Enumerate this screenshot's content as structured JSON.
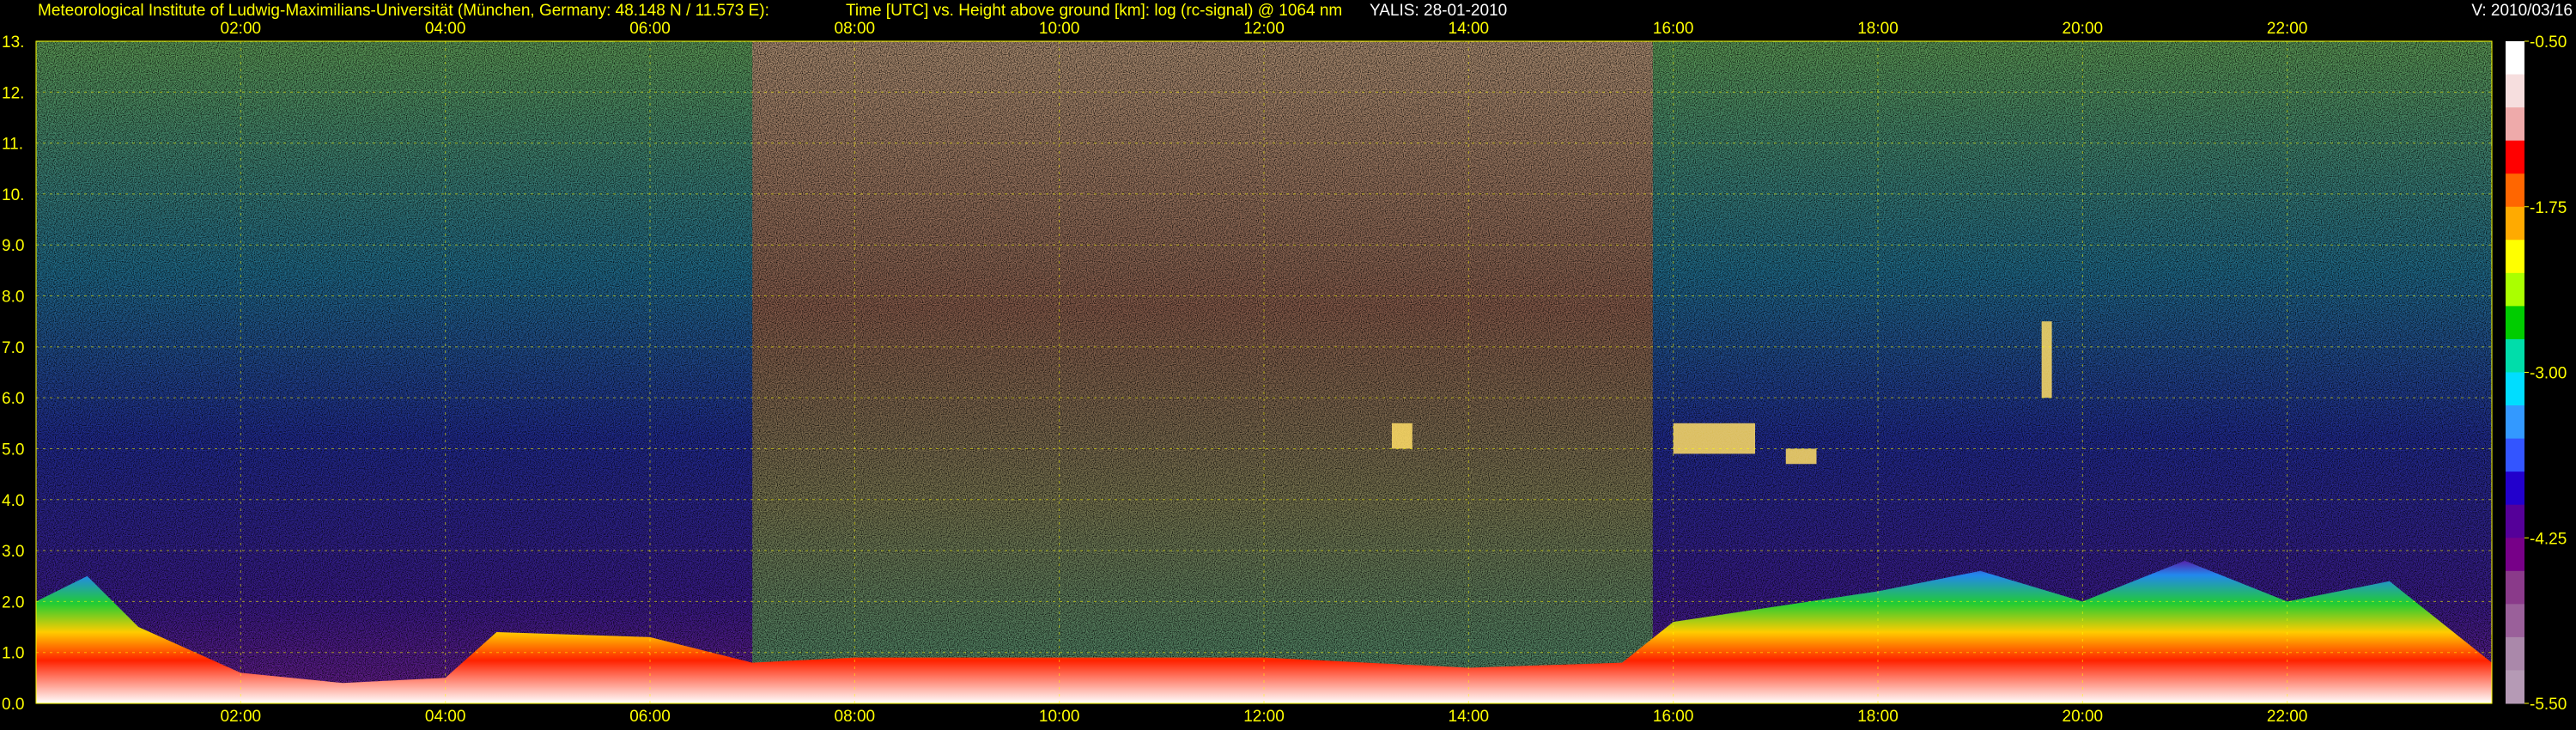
{
  "header": {
    "institute": "Meteorological Institute of Ludwig-Maximilians-Universität (München, Germany: 48.148 N / 11.573 E):",
    "title": "Time [UTC] vs. Height above ground [km]: log (rc-signal) @ 1064 nm",
    "instrument": "YALIS: 28-01-2010",
    "version": "V: 2010/03/16"
  },
  "chart_data": {
    "type": "heatmap",
    "x_ticks": [
      "02:00",
      "04:00",
      "06:00",
      "08:00",
      "10:00",
      "12:00",
      "14:00",
      "16:00",
      "18:00",
      "20:00",
      "22:00"
    ],
    "xlim_hours": [
      0,
      24
    ],
    "y_ticks": [
      "0.0",
      "1.0",
      "2.0",
      "3.0",
      "4.0",
      "5.0",
      "6.0",
      "7.0",
      "8.0",
      "9.0",
      "10.",
      "11.",
      "12.",
      "13."
    ],
    "ylim_km": [
      0,
      13
    ],
    "grid": true,
    "colorbar": {
      "labels": [
        "-0.50",
        "-1.75",
        "-3.00",
        "-4.25",
        "-5.50"
      ],
      "range": [
        -5.5,
        -0.5
      ],
      "colors": [
        "#ffffff",
        "#f6dede",
        "#eeaaaa",
        "#ff0000",
        "#ff6600",
        "#ffaa00",
        "#ffff00",
        "#aaff00",
        "#00cc00",
        "#00ddaa",
        "#00ddff",
        "#3399ff",
        "#3355ff",
        "#2200cc",
        "#550099",
        "#770088",
        "#8a3a8a",
        "#9a609a",
        "#aa88aa",
        "#b59ab5"
      ]
    },
    "boundary_layer_top_km": [
      [
        0.0,
        2.0
      ],
      [
        0.5,
        2.5
      ],
      [
        1.0,
        1.5
      ],
      [
        2.0,
        0.6
      ],
      [
        3.0,
        0.4
      ],
      [
        4.0,
        0.5
      ],
      [
        4.5,
        1.4
      ],
      [
        6.0,
        1.3
      ],
      [
        7.0,
        0.8
      ],
      [
        8.0,
        0.9
      ],
      [
        10.0,
        0.9
      ],
      [
        12.0,
        0.9
      ],
      [
        14.0,
        0.7
      ],
      [
        15.5,
        0.8
      ],
      [
        16.0,
        1.6
      ],
      [
        18.0,
        2.2
      ],
      [
        19.0,
        2.6
      ],
      [
        20.0,
        2.0
      ],
      [
        21.0,
        2.8
      ],
      [
        22.0,
        2.0
      ],
      [
        23.0,
        2.4
      ],
      [
        24.0,
        0.8
      ]
    ],
    "cloud_patches": [
      {
        "time_h": [
          13.25,
          13.45
        ],
        "height_km": [
          5.0,
          5.5
        ]
      },
      {
        "time_h": [
          16.0,
          16.8
        ],
        "height_km": [
          4.9,
          5.5
        ]
      },
      {
        "time_h": [
          17.1,
          17.4
        ],
        "height_km": [
          4.7,
          5.0
        ]
      },
      {
        "time_h": [
          19.6,
          19.7
        ],
        "height_km": [
          6.0,
          7.5
        ]
      }
    ]
  }
}
